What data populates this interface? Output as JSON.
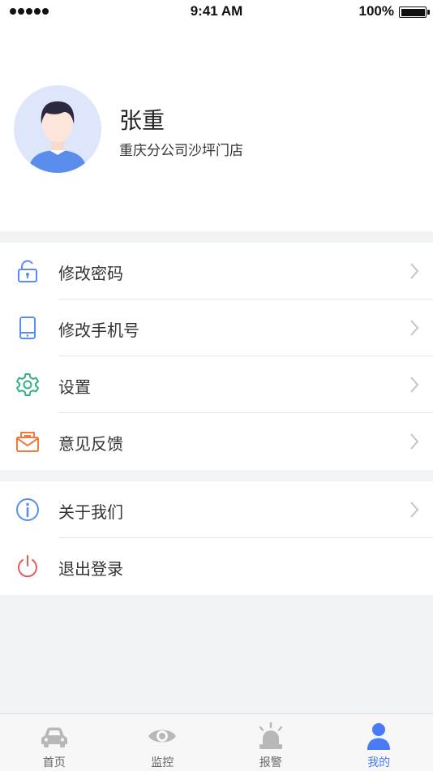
{
  "status_bar": {
    "time": "9:41 AM",
    "battery": "100%"
  },
  "profile": {
    "name": "张重",
    "org": "重庆分公司沙坪门店",
    "avatar_icon": "user-avatar"
  },
  "menu_group_1": [
    {
      "label": "修改密码",
      "icon": "unlock-icon",
      "color": "#5b8def"
    },
    {
      "label": "修改手机号",
      "icon": "phone-icon",
      "color": "#5b8def"
    },
    {
      "label": "设置",
      "icon": "gear-icon",
      "color": "#2fb380"
    },
    {
      "label": "意见反馈",
      "icon": "mail-icon",
      "color": "#f07b3f"
    }
  ],
  "menu_group_2": [
    {
      "label": "关于我们",
      "icon": "info-icon",
      "color": "#5b8def"
    },
    {
      "label": "退出登录",
      "icon": "power-icon",
      "color": "#e95a5a"
    }
  ],
  "tab_bar": [
    {
      "label": "首页",
      "icon": "car-icon",
      "active": false
    },
    {
      "label": "监控",
      "icon": "eye-icon",
      "active": false
    },
    {
      "label": "报警",
      "icon": "alarm-icon",
      "active": false
    },
    {
      "label": "我的",
      "icon": "person-icon",
      "active": true
    }
  ],
  "colors": {
    "accent": "#4a7bf7",
    "inactive_tab": "#b8b8b8",
    "background": "#f2f3f5"
  }
}
